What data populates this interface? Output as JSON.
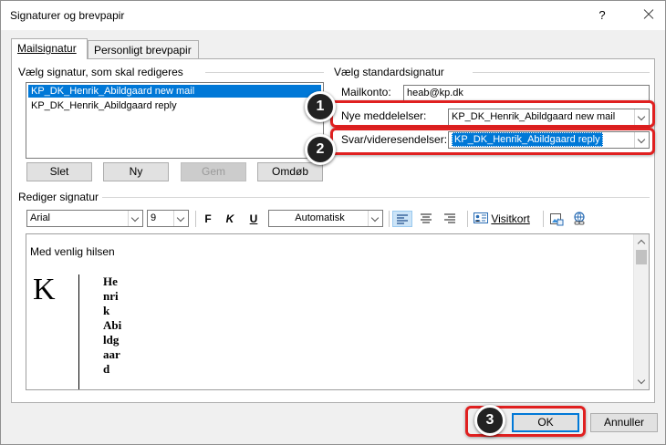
{
  "window": {
    "title": "Signaturer og brevpapir",
    "help": "?"
  },
  "tabs": [
    {
      "label": "Mailsignatur"
    },
    {
      "label": "Personligt brevpapir"
    }
  ],
  "left": {
    "heading": "Vælg signatur, som skal redigeres",
    "signatures": [
      "KP_DK_Henrik_Abildgaard new mail",
      "KP_DK_Henrik_Abildgaard reply"
    ],
    "buttons": {
      "delete": "Slet",
      "new": "Ny",
      "save": "Gem",
      "rename": "Omdøb"
    }
  },
  "right": {
    "heading": "Vælg standardsignatur",
    "account_label": "Mailkonto:",
    "account_value": "heab@kp.dk",
    "new_messages_label": "Nye meddelelser:",
    "new_messages_value": "KP_DK_Henrik_Abildgaard new mail",
    "replies_label": "Svar/videresendelser:",
    "replies_value": "KP_DK_Henrik_Abildgaard reply"
  },
  "editor": {
    "heading": "Rediger signatur",
    "font": "Arial",
    "size": "9",
    "bold": "F",
    "italic": "K",
    "underline": "U",
    "color": "Automatisk",
    "business_card": "Visitkort",
    "greeting": "Med venlig hilsen",
    "logo": "K",
    "name_lines": [
      "He",
      "nri",
      "k",
      "Abi",
      "ldg",
      "aar",
      "d"
    ]
  },
  "footer": {
    "ok": "OK",
    "cancel": "Annuller"
  },
  "callouts": [
    "1",
    "2",
    "3"
  ],
  "colors": {
    "accent": "#0078d7",
    "callout": "#e02020"
  }
}
